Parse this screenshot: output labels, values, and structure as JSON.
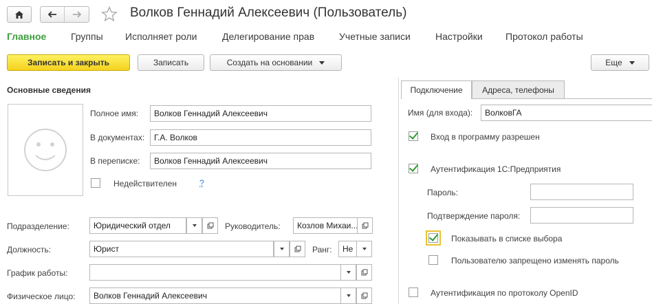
{
  "window": {
    "title": "Волков Геннадий Алексеевич (Пользователь)"
  },
  "nav": {
    "tabs": [
      {
        "label": "Главное"
      },
      {
        "label": "Группы"
      },
      {
        "label": "Исполняет роли"
      },
      {
        "label": "Делегирование прав"
      },
      {
        "label": "Учетные записи"
      },
      {
        "label": "Настройки"
      },
      {
        "label": "Протокол работы"
      }
    ]
  },
  "toolbar": {
    "save_close_label": "Записать и закрыть",
    "save_label": "Записать",
    "create_based_label": "Создать на основании",
    "more_label": "Еще"
  },
  "main": {
    "section_title": "Основные сведения",
    "full_name_label": "Полное имя:",
    "full_name_value": "Волков Геннадий Алексеевич",
    "in_docs_label": "В документах:",
    "in_docs_value": "Г.А. Волков",
    "in_correspondence_label": "В переписке:",
    "in_correspondence_value": "Волков Геннадий Алексеевич",
    "invalid_label": "Недействителен",
    "help_label": "?",
    "department_label": "Подразделение:",
    "department_value": "Юридический отдел",
    "manager_label": "Руководитель:",
    "manager_value": "Козлов Михаи...",
    "position_label": "Должность:",
    "position_value": "Юрист",
    "rank_label": "Ранг:",
    "rank_value": "Не",
    "schedule_label": "График работы:",
    "schedule_value": "",
    "person_label": "Физическое лицо:",
    "person_value": "Волков Геннадий Алексеевич"
  },
  "right": {
    "tabs": [
      {
        "label": "Подключение"
      },
      {
        "label": "Адреса, телефоны"
      }
    ],
    "login_label": "Имя (для входа):",
    "login_value": "ВолковГА",
    "login_allowed_label": "Вход в программу разрешен",
    "login_allowed": true,
    "auth_1c_label": "Аутентификация 1С:Предприятия",
    "auth_1c": true,
    "password_label": "Пароль:",
    "password_confirm_label": "Подтверждение пароля:",
    "show_in_list_label": "Показывать в списке выбора",
    "show_in_list": true,
    "forbid_change_label": "Пользователю запрещено изменять пароль",
    "forbid_change": false,
    "openid_label": "Аутентификация по протоколу OpenID",
    "openid": false
  },
  "colors": {
    "accent_green": "#3d9e3d",
    "primary_button": "#f4d21d",
    "focus_outline": "#e9c22e",
    "link_blue": "#2a7fd4"
  }
}
